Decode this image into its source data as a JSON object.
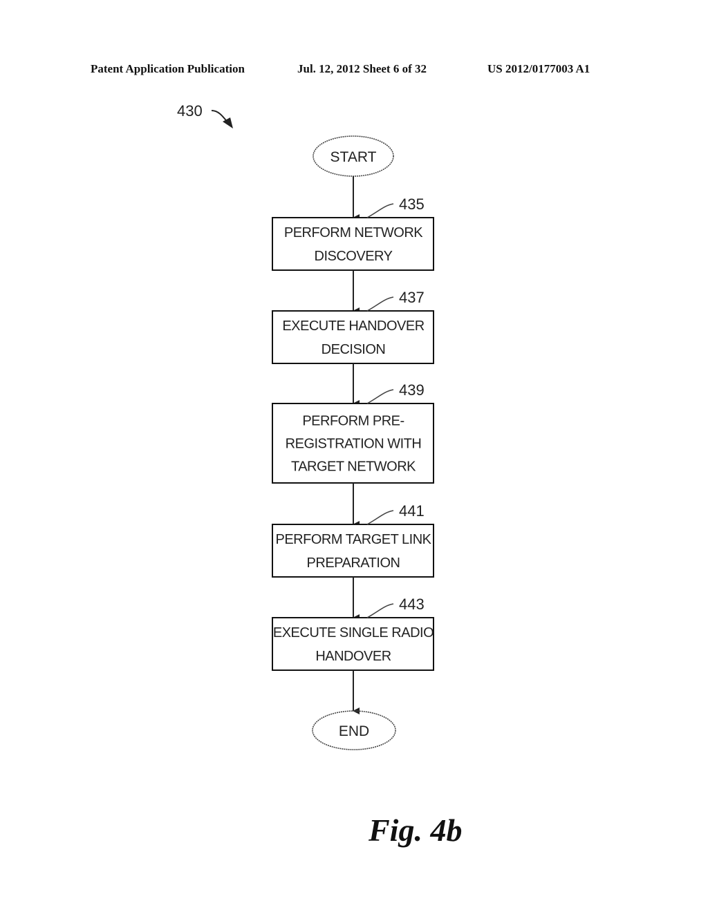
{
  "header": {
    "left": "Patent Application Publication",
    "middle": "Jul. 12, 2012   Sheet 6 of 32",
    "right": "US 2012/0177003 A1"
  },
  "diagram": {
    "reference": "430",
    "start_label": "START",
    "end_label": "END",
    "steps": [
      {
        "ref": "435",
        "lines": [
          "PERFORM NETWORK",
          "DISCOVERY"
        ]
      },
      {
        "ref": "437",
        "lines": [
          "EXECUTE HANDOVER",
          "DECISION"
        ]
      },
      {
        "ref": "439",
        "lines": [
          "PERFORM PRE-",
          "REGISTRATION WITH",
          "TARGET NETWORK"
        ]
      },
      {
        "ref": "441",
        "lines": [
          "PERFORM TARGET LINK",
          "PREPARATION"
        ]
      },
      {
        "ref": "443",
        "lines": [
          "EXECUTE SINGLE RADIO",
          "HANDOVER"
        ]
      }
    ]
  },
  "figure_label": "Fig. 4b"
}
